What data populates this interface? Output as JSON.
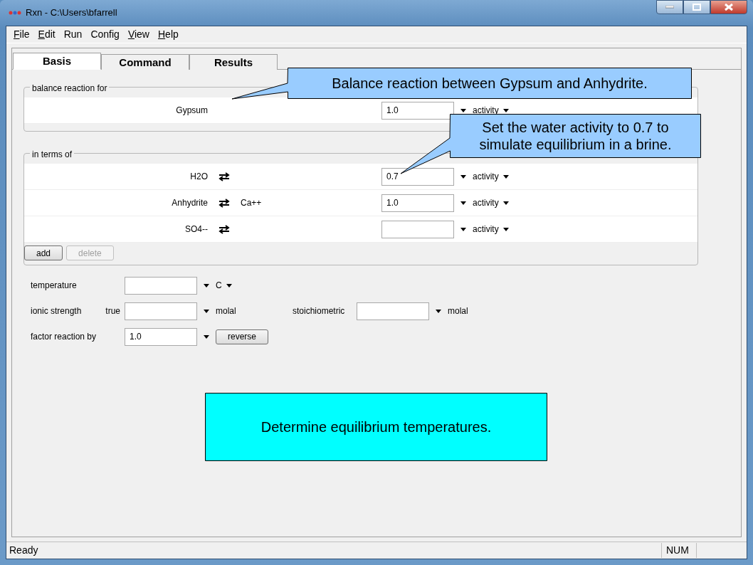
{
  "window": {
    "title": "Rxn - C:\\Users\\bfarrell"
  },
  "menu": [
    {
      "label": "File",
      "mnemonic": true
    },
    {
      "label": "Edit",
      "mnemonic": true
    },
    {
      "label": "Run",
      "mnemonic": false
    },
    {
      "label": "Config",
      "mnemonic": false
    },
    {
      "label": "View",
      "mnemonic": true
    },
    {
      "label": "Help",
      "mnemonic": true
    }
  ],
  "tabs": [
    {
      "label": "Basis",
      "selected": true
    },
    {
      "label": "Command",
      "selected": false
    },
    {
      "label": "Results",
      "selected": false
    }
  ],
  "groups": [
    {
      "legend": "balance reaction for",
      "rows": [
        {
          "species": "Gypsum",
          "swap": false,
          "value": "1.0",
          "unit": "activity"
        }
      ]
    },
    {
      "legend": "in terms of",
      "rows": [
        {
          "species": "H2O",
          "swap": true,
          "value": "0.7",
          "unit": "activity"
        },
        {
          "species": "Anhydrite",
          "swap": true,
          "product": "Ca++",
          "value": "1.0",
          "unit": "activity"
        },
        {
          "species": "SO4--",
          "swap": true,
          "unit": "activity"
        }
      ],
      "buttons": [
        {
          "label": "add",
          "disabled": false
        },
        {
          "label": "delete",
          "disabled": true
        }
      ]
    }
  ],
  "params": {
    "temperature": {
      "label": "temperature",
      "unit": "C"
    },
    "ionic_strength": {
      "label": "ionic strength",
      "sublabel": "true",
      "unit": "molal",
      "stoich_label": "stoichiometric",
      "stoich_unit": "molal"
    },
    "factor": {
      "label": "factor reaction by",
      "value": "1.0",
      "button": "reverse"
    }
  },
  "callouts": [
    {
      "text": "Balance reaction between Gypsum and Anhydrite.",
      "kind": "pointer",
      "color": "#99ccff"
    },
    {
      "text": "Set the water activity to 0.7 to simulate equilibrium in a brine.",
      "kind": "pointer",
      "color": "#99ccff"
    },
    {
      "text": "Determine equilibrium temperatures.",
      "kind": "plain",
      "color": "#00ffff"
    }
  ],
  "status_bar": {
    "message": "Ready",
    "indicator": "NUM"
  }
}
